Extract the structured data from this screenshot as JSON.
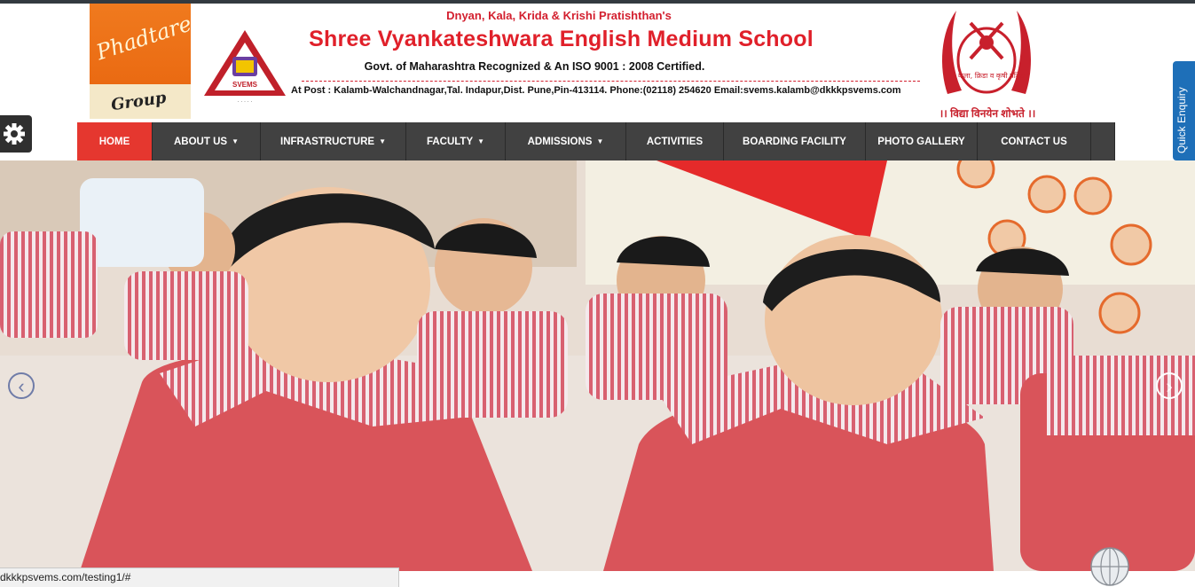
{
  "header": {
    "trust": "Dnyan, Kala, Krida & Krishi Pratishthan's",
    "school_name": "Shree Vyankateshwara English Medium School",
    "recognition": "Govt. of Maharashtra Recognized & An ISO 9001 : 2008 Certified.",
    "address": "At Post : Kalamb-Walchandnagar,Tal. Indapur,Dist. Pune,Pin-413114. Phone:(02118) 254620 Email:svems.kalamb@dkkkpsvems.com",
    "logo_left_line1": "Phadtare",
    "logo_left_line2": "Group",
    "logo_svems": "SVEMS",
    "emblem_text": "ज्ञान, कला, क्रिडा व कृषी प्रतिष्ठान",
    "motto": "।। विद्या विनयेन शोभते ।।"
  },
  "nav": {
    "items": [
      {
        "label": "HOME",
        "dropdown": false,
        "active": true
      },
      {
        "label": "ABOUT US",
        "dropdown": true
      },
      {
        "label": "INFRASTRUCTURE",
        "dropdown": true
      },
      {
        "label": "FACULTY",
        "dropdown": true
      },
      {
        "label": "ADMISSIONS",
        "dropdown": true
      },
      {
        "label": "ACTIVITIES",
        "dropdown": false
      },
      {
        "label": "BOARDING FACILITY",
        "dropdown": false
      },
      {
        "label": "PHOTO GALLERY",
        "dropdown": false
      },
      {
        "label": "CONTACT US",
        "dropdown": false
      }
    ]
  },
  "side": {
    "quick_enquiry": "Quick Enquiry",
    "settings_icon": "gear-icon"
  },
  "slider": {
    "prev_icon": "chevron-left-icon",
    "next_icon": "chevron-right-icon"
  },
  "status_url": "dkkkpsvems.com/testing1/#",
  "colors": {
    "accent_red": "#e5372f",
    "nav_bg": "#414141",
    "quick_blue": "#1e6fb8"
  }
}
